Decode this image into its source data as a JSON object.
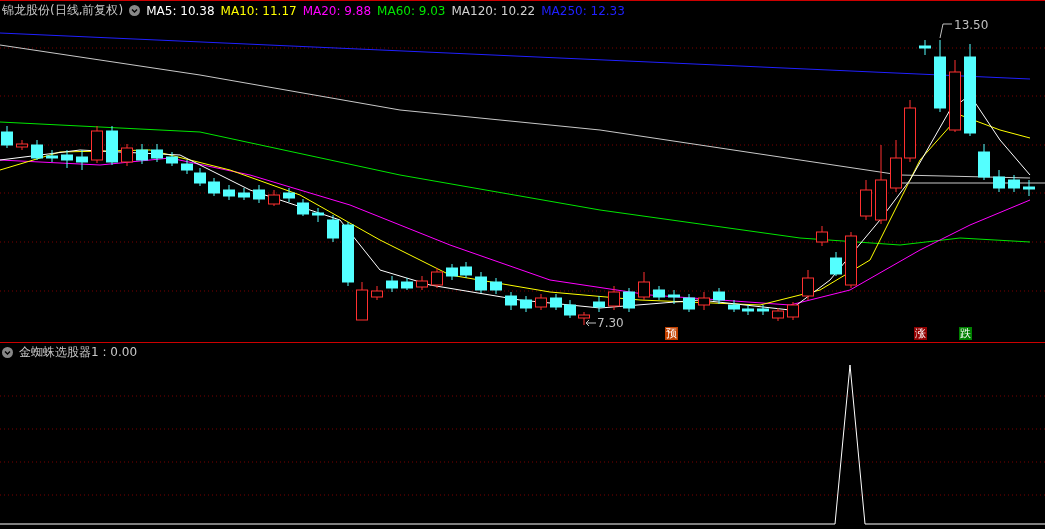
{
  "main_pane": {
    "title": "锦龙股份(日线,前复权)",
    "legend": [
      {
        "label": "MA5: 10.38",
        "color": "#ffffff"
      },
      {
        "label": "MA10: 11.17",
        "color": "#ffff00"
      },
      {
        "label": "MA20: 9.88",
        "color": "#ff00ff"
      },
      {
        "label": "MA60: 9.03",
        "color": "#00e600"
      },
      {
        "label": "MA120: 10.22",
        "color": "#d0d0d0"
      },
      {
        "label": "MA250: 12.33",
        "color": "#2020ff"
      }
    ],
    "high_label": "13.50",
    "low_label": "7.30",
    "markers": [
      {
        "label": "预",
        "color": "#c04000"
      },
      {
        "label": "涨",
        "color": "#900000"
      },
      {
        "label": "跌",
        "color": "#008000"
      }
    ]
  },
  "indicator_pane": {
    "title": "金蜘蛛选股器1 : 0.00"
  }
}
